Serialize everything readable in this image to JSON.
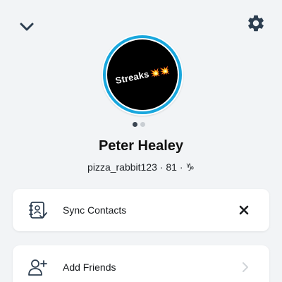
{
  "profile": {
    "name": "Peter Healey",
    "username": "pizza_rabbit123",
    "score": "81",
    "zodiac": "♑",
    "separator": "·",
    "story_text": "Streaks",
    "story_emoji": "💥💥"
  },
  "pager": {
    "count": 2,
    "active": 0
  },
  "cards": {
    "sync_contacts": {
      "label": "Sync Contacts"
    },
    "add_friends": {
      "label": "Add Friends"
    }
  },
  "colors": {
    "background": "#f2f4f6",
    "ring": "#19a7dd",
    "icon": "#2d3e50"
  },
  "icons": {
    "back": "chevron-down-icon",
    "settings": "gear-icon",
    "sync": "contacts-book-icon",
    "close": "close-icon",
    "add": "add-person-icon",
    "arrow": "chevron-right-icon"
  }
}
